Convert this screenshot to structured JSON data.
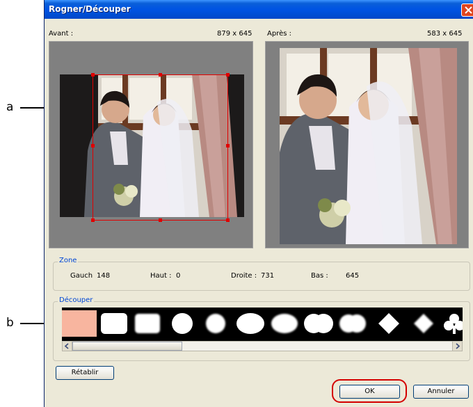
{
  "callouts": {
    "a": "a",
    "b": "b"
  },
  "window": {
    "title": "Rogner/Découper"
  },
  "before": {
    "label": "Avant :",
    "size": "879 x 645"
  },
  "after": {
    "label": "Après :",
    "size": "583 x 645"
  },
  "zone": {
    "title": "Zone",
    "left_label": "Gauch",
    "left_value": "148",
    "top_label": "Haut :",
    "top_value": "0",
    "right_label": "Droite :",
    "right_value": "731",
    "bottom_label": "Bas :",
    "bottom_value": "645"
  },
  "cut": {
    "title": "Découper",
    "shapes": [
      "none",
      "rounded-rect",
      "soft-rect",
      "circle",
      "soft-circle",
      "ellipse",
      "soft-ellipse",
      "double-circle",
      "soft-double-circle",
      "diamond",
      "soft-diamond",
      "club"
    ]
  },
  "buttons": {
    "reset": "Rétablir",
    "ok": "OK",
    "cancel": "Annuler"
  },
  "colors": {
    "title_bar": "#0054e3",
    "crop": "#e00000",
    "group_title": "#0046d5",
    "selected_shape": "#f8b59f"
  }
}
